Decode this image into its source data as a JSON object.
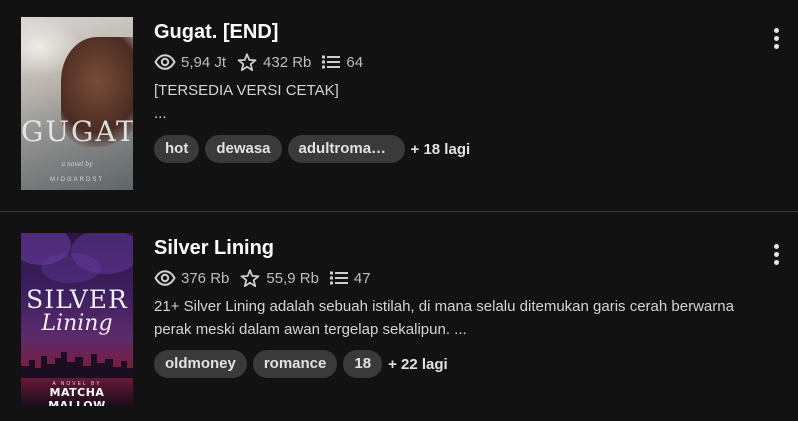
{
  "stories": [
    {
      "title": "Gugat. [END]",
      "cover": {
        "title": "GUGAT.",
        "subtitle": "a novel by",
        "author": "MIDGARDST"
      },
      "reads": "5,94 Jt",
      "votes": "432 Rb",
      "parts": "64",
      "description_line1": "[TERSEDIA VERSI CETAK]",
      "description_line2": "...",
      "tags": [
        "hot",
        "dewasa",
        "adultromance"
      ],
      "more_tags": "+ 18 lagi"
    },
    {
      "title": "Silver Lining",
      "cover": {
        "title_line1": "SILVER",
        "title_line2": "Lining",
        "subtitle": "A NOVEL BY",
        "author": "MATCHA MALLOW"
      },
      "reads": "376 Rb",
      "votes": "55,9 Rb",
      "parts": "47",
      "description_line1": "21+ Silver Lining adalah sebuah istilah, di mana selalu ditemukan garis cerah berwarna",
      "description_line2": "perak meski dalam awan tergelap sekalipun. ...",
      "tags": [
        "oldmoney",
        "romance",
        "18"
      ],
      "more_tags": "+ 22 lagi"
    }
  ],
  "icons": {
    "reads": "eye-icon",
    "votes": "star-icon",
    "parts": "list-icon",
    "menu": "more-vertical-icon"
  },
  "colors": {
    "background": "#121212",
    "tag_bg": "#3a3a3a",
    "text_primary": "#ffffff",
    "text_secondary": "#bdbdbd"
  }
}
